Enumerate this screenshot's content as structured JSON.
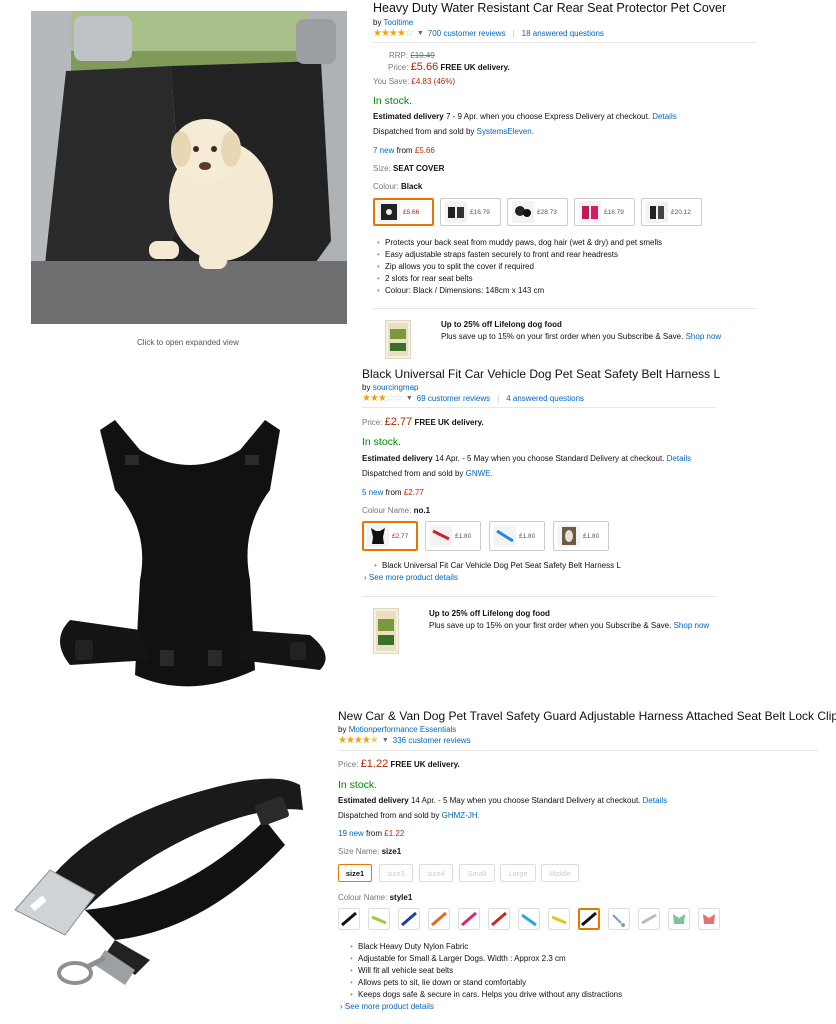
{
  "p1": {
    "title": "Heavy Duty Water Resistant Car Rear Seat Protector Pet Cover",
    "by": "by",
    "brand": "Tooltime",
    "reviews": "700 customer reviews",
    "questions": "18 answered questions",
    "rrp_label": "RRP:",
    "rrp": "£10.49",
    "price_label": "Price:",
    "price": "£5.66",
    "free_delivery": "FREE UK delivery.",
    "save_label": "You Save:",
    "save": "£4.83 (46%)",
    "stock": "In stock.",
    "est_label": "Estimated delivery",
    "est_text": "7 - 9 Apr. when you choose Express Delivery at checkout.",
    "details": "Details",
    "dispatch": "Dispatched from and sold by",
    "seller": "SystemsEleven.",
    "new_count": "7 new",
    "new_from": "from",
    "new_price": "£5.66",
    "size_label": "Size:",
    "size_value": "SEAT COVER",
    "colour_label": "Colour:",
    "colour_value": "Black",
    "swatch_prices": [
      "£5.66",
      "£16.79",
      "£28.73",
      "£16.79",
      "£20.12"
    ],
    "bullets": [
      "Protects your back seat from muddy paws, dog hair (wet & dry) and pet smells",
      "Easy adjustable straps fasten securely to front and rear headrests",
      "Zip allows you to split the cover if required",
      "2 slots for rear seat belts",
      "Colour: Black / Dimensions: 148cm x 143 cm"
    ],
    "promo_title": "Up to 25% off Lifelong dog food",
    "promo_text": "Plus save up to 15% on your first order when you Subscribe & Save.",
    "promo_link": "Shop now",
    "expand": "Click to open expanded view"
  },
  "p2": {
    "title": "Black Universal Fit Car Vehicle Dog Pet Seat Safety Belt Harness L",
    "by": "by",
    "brand": "sourcingmap",
    "reviews": "69 customer reviews",
    "questions": "4 answered questions",
    "price_label": "Price:",
    "price": "£2.77",
    "free_delivery": "FREE UK delivery.",
    "stock": "In stock.",
    "est_label": "Estimated delivery",
    "est_text": "14 Apr. - 5 May when you choose Standard Delivery at checkout.",
    "details": "Details",
    "dispatch": "Dispatched from and sold by",
    "seller": "GNWE.",
    "new_count": "5 new",
    "new_from": "from",
    "new_price": "£2.77",
    "colour_label": "Colour Name:",
    "colour_value": "no.1",
    "swatch_prices": [
      "£2.77",
      "£1.80",
      "£1.80",
      "£1.80"
    ],
    "bullets": [
      "Black Universal Fit Car Vehicle Dog Pet Seat Safety Belt Harness L"
    ],
    "more": "See more product details",
    "promo_title": "Up to 25% off Lifelong dog food",
    "promo_text": "Plus save up to 15% on your first order when you Subscribe & Save.",
    "promo_link": "Shop now"
  },
  "p3": {
    "title": "New Car & Van Dog Pet Travel Safety Guard Adjustable Harness Attached Seat Belt Lock Clip",
    "by": "by",
    "brand": "Motionperformance Essentials",
    "reviews": "336 customer reviews",
    "price_label": "Price:",
    "price": "£1.22",
    "free_delivery": "FREE UK delivery.",
    "stock": "In stock.",
    "est_label": "Estimated delivery",
    "est_text": "14 Apr. - 5 May when you choose Standard Delivery at checkout.",
    "details": "Details",
    "dispatch": "Dispatched from and sold by",
    "seller": "GHMZ-JH.",
    "new_count": "19 new",
    "new_from": "from",
    "new_price": "£1.22",
    "size_label": "Size Name:",
    "size_value": "size1",
    "sizes": [
      "size1",
      "size3",
      "size4",
      "Small",
      "Large",
      "Middle"
    ],
    "colour_label": "Colour Name:",
    "colour_value": "style1",
    "bullets": [
      "Black Heavy Duty Nylon Fabric",
      "Adjustable for Small & Larger Dogs. Width : Approx 2.3 cm",
      "Will fit all vehicle seat belts",
      "Allows pets to sit, lie down or stand comfortably",
      "Keeps dogs safe & secure in cars. Helps you drive without any distractions"
    ],
    "more": "See more product details"
  },
  "colors": {
    "link": "#0066c0",
    "price": "#b12704",
    "stock": "#008a00",
    "star": "#f0a30a",
    "selected_border": "#e77600"
  }
}
